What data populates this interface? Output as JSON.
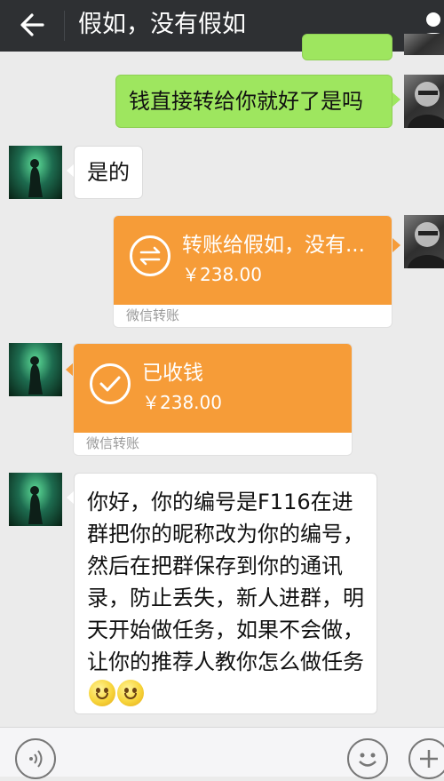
{
  "header": {
    "title": "假如，没有假如"
  },
  "messages": {
    "m1": {
      "text": "钱直接转给你就好了是吗"
    },
    "m2": {
      "text": "是的"
    },
    "m3": {
      "title": "转账给假如，没有...",
      "amount": "￥238.00",
      "footer": "微信转账"
    },
    "m4": {
      "title": "已收钱",
      "amount": "￥238.00",
      "footer": "微信转账"
    },
    "m5": {
      "text": "你好，你的编号是F116在进群把你的昵称改为你的编号，然后在把群保存到你的通讯录，防止丢失，新人进群，明天开始做任务，如果不会做，让你的推荐人教你怎么做任务"
    }
  },
  "colors": {
    "header_bg": "#2e3033",
    "sent_bubble": "#9ee65f",
    "transfer_orange": "#f69c38",
    "chat_bg": "#ebebeb"
  },
  "icons": {
    "back": "back-arrow-icon",
    "contact": "person-icon",
    "transfer": "transfer-arrows-icon",
    "received": "checkmark-icon",
    "voice": "voice-icon",
    "emoji": "emoji-icon",
    "more": "plus-icon"
  }
}
